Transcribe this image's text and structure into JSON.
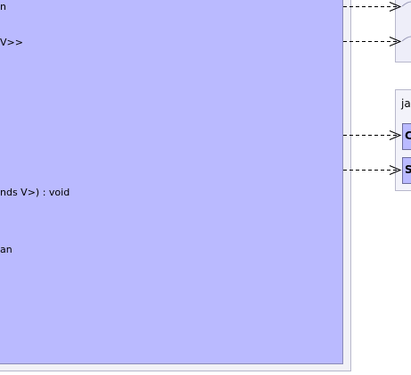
{
  "main_class": {
    "members": [
      "n",
      "V>>",
      "nds V>) : void",
      "an"
    ]
  },
  "package_box": {
    "title": "ja",
    "items": [
      "C",
      "S"
    ]
  },
  "colors": {
    "class_fill": "#babaff",
    "frame_fill": "#f1f1f6",
    "border": "#8a8ab8",
    "arrow": "#000000"
  }
}
